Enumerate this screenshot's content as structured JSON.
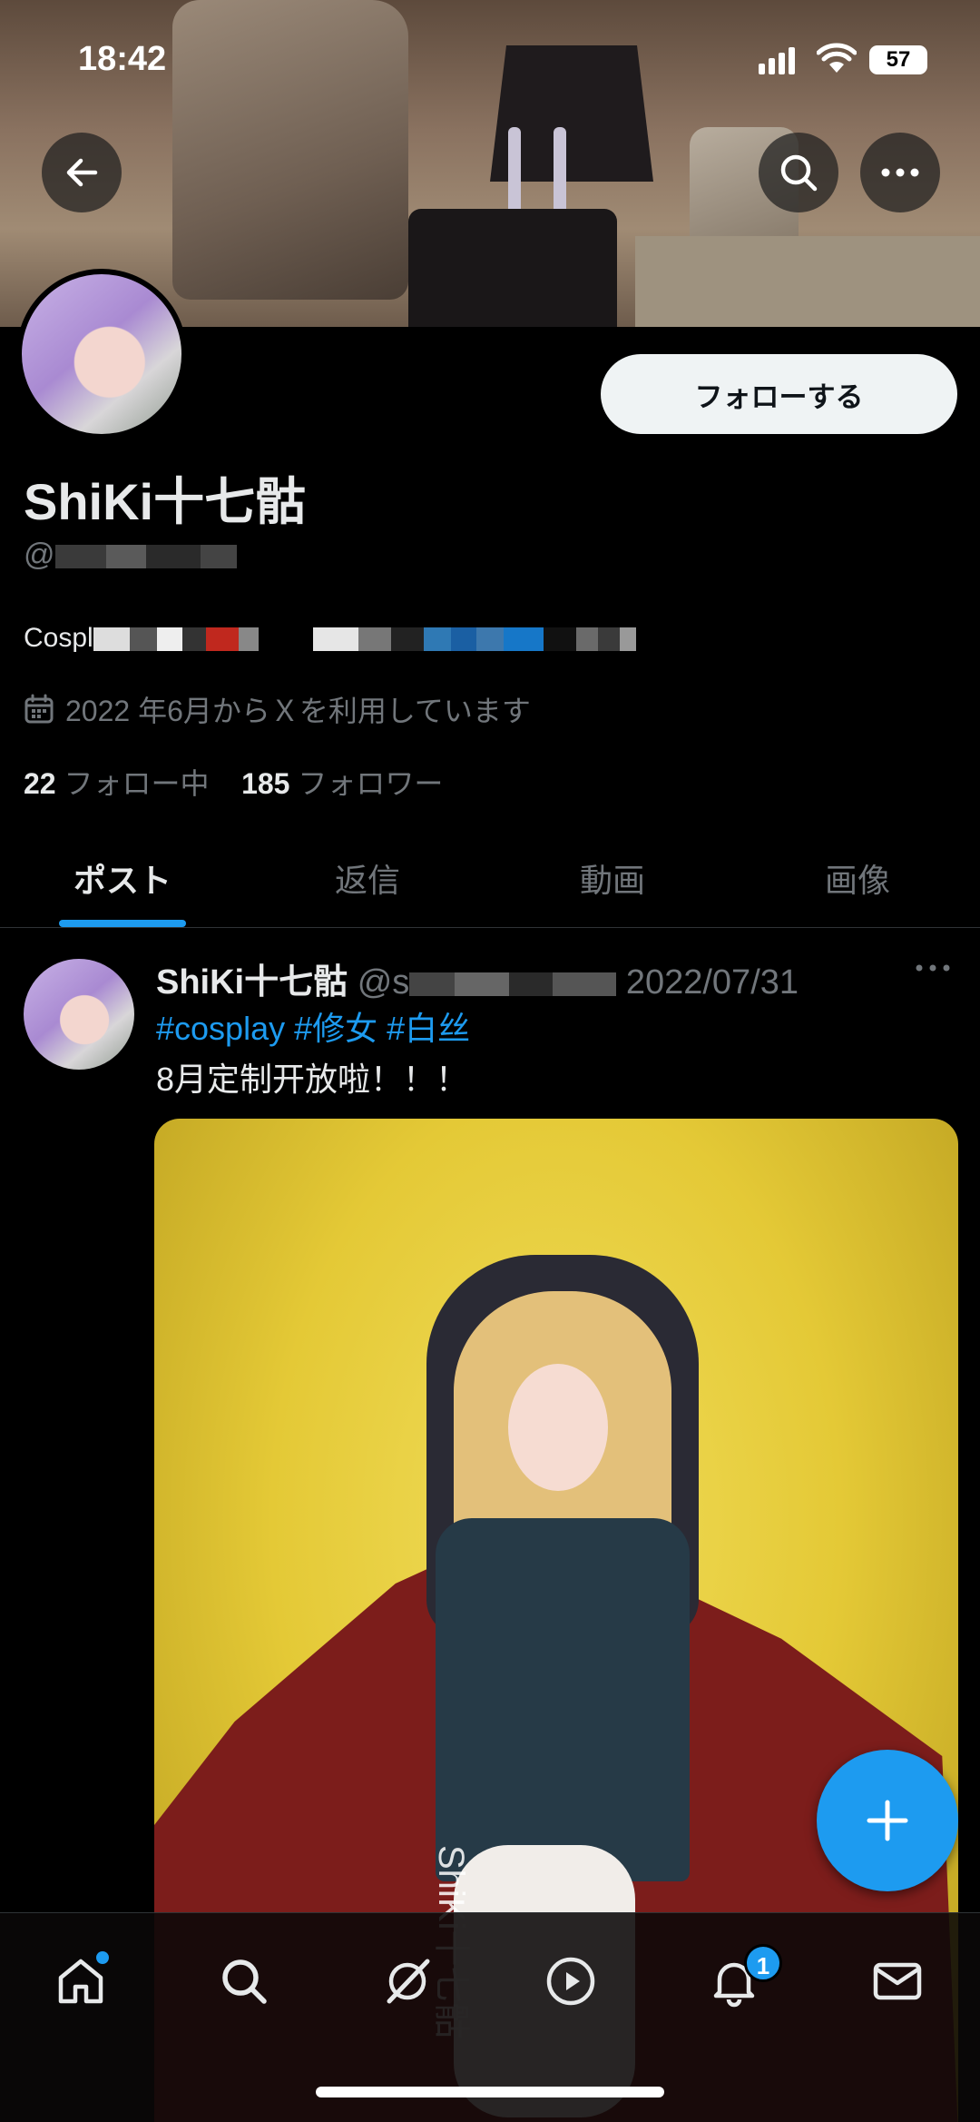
{
  "status_bar": {
    "time": "18:42",
    "battery": "57"
  },
  "profile": {
    "follow_label": "フォローする",
    "name": "ShiKi十七骷",
    "handle_prefix": "@",
    "bio_prefix": "Cospl",
    "joined": "2022 年6月からＸを利用しています",
    "following_count": "22",
    "following_label": "フォロー中",
    "followers_count": "185",
    "followers_label": "フォロワー"
  },
  "tabs": [
    {
      "label": "ポスト",
      "active": true
    },
    {
      "label": "返信"
    },
    {
      "label": "動画"
    },
    {
      "label": "画像"
    }
  ],
  "post": {
    "name": "ShiKi十七骷",
    "handle": "@s",
    "date": "2022/07/31",
    "hashtags": [
      "#cosplay",
      "#修女",
      "#白丝"
    ],
    "text": "8月定制开放啦！！！",
    "media_watermark": "ShiKi十七骷"
  },
  "bottom_nav": {
    "items": [
      "home-icon",
      "search-icon",
      "grok-icon",
      "play-icon",
      "notifications-icon",
      "messages-icon"
    ],
    "notification_badge": "1"
  },
  "colors": {
    "accent": "#1d9bf0",
    "background": "#000000",
    "muted_text": "#71767b"
  }
}
